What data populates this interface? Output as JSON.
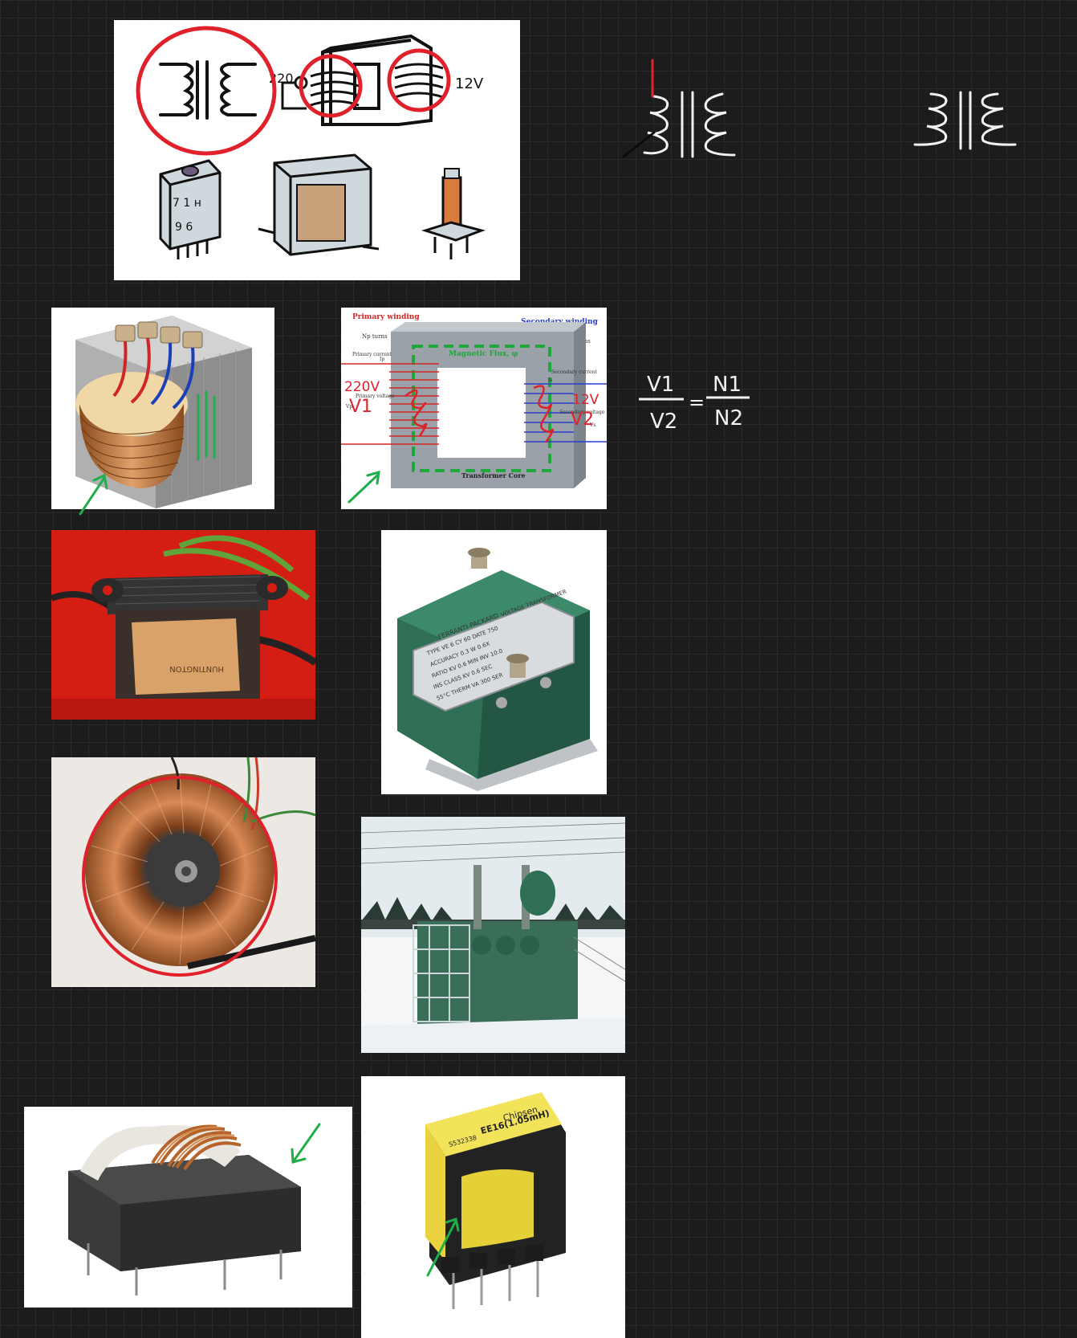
{
  "cards": {
    "schematic": {
      "label_220": "220",
      "label_12v": "12V",
      "pins_top": "7 1 ʜ",
      "pins_bottom": "9 6"
    },
    "diagram": {
      "primary_winding": "Primary winding",
      "np_turns": "Np turns",
      "secondary_winding": "Secondary winding",
      "ns_turns": "Ns turns",
      "magnetic_flux": "Magnetic Flux, φ",
      "primary_current": "Primary current",
      "primary_voltage": "Primary voltage",
      "secondary_current": "Secondary current",
      "secondary_voltage": "Secondary voltage",
      "ip": "Ip",
      "is": "Is",
      "vp": "Vp",
      "vs": "Vs",
      "core_label": "Transformer Core"
    },
    "potential_transformer": {
      "brand": "FERRANTI-PACKARD",
      "type_title": "VOLTAGE TRANSFORMER",
      "line1": "TYPE VE 6   CY 60   DATE 750",
      "line2": "ACCURACY  0.3 W  0.6X",
      "line3": "RATIO          KV 0.6   MIN INV 10.0",
      "line4": "INS CLASS KV 0.6   SEC",
      "line5": "55°C THERM VA 300   SER"
    },
    "green_transformer": {
      "label": "HUNTINGTON"
    },
    "ee16": {
      "brand": "Chipsen",
      "model": "EE16(1.05mH)",
      "code": "S532338"
    }
  },
  "annotations": {
    "diagram_primary_volt": "220V",
    "diagram_primary_v": "V1",
    "diagram_secondary_volt": "12V",
    "diagram_secondary_v": "V2",
    "formula_v1": "V1",
    "formula_v2": "V2",
    "formula_eq": "=",
    "formula_n1": "N1",
    "formula_n2": "N2"
  },
  "colors": {
    "canvas": "#1c1c1c",
    "grid": "#2a2a2a",
    "ink_red": "#e0202a",
    "ink_green": "#1fae4a",
    "ink_white": "#f2f2f2",
    "copper": "#c27a3e",
    "core_grey": "#9a9a9a",
    "enclosure_green": "#2f6f55"
  }
}
